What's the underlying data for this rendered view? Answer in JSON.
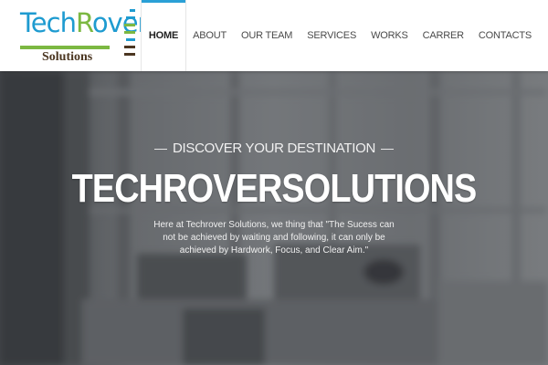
{
  "brand": {
    "name_part1": "Tech",
    "name_part2": "R",
    "name_part3": "over",
    "subtitle": "Solutions",
    "colors": {
      "blue": "#1e9bd0",
      "green": "#7cb842",
      "brown": "#4b3621"
    }
  },
  "nav": {
    "items": [
      {
        "label": "HOME",
        "active": true
      },
      {
        "label": "ABOUT",
        "active": false
      },
      {
        "label": "OUR TEAM",
        "active": false
      },
      {
        "label": "SERVICES",
        "active": false
      },
      {
        "label": "WORKS",
        "active": false
      },
      {
        "label": "CARRER",
        "active": false
      },
      {
        "label": "CONTACTS",
        "active": false
      }
    ],
    "accent": "#2aa0d6"
  },
  "hero": {
    "tagline": "DISCOVER YOUR DESTINATION",
    "title": "TECHROVERSOLUTIONS",
    "description": "Here at Techrover Solutions, we thing that \"The Sucess can not be achieved by waiting and following, it can only be achieved by Hardwork, Focus, and Clear Aim.\""
  }
}
